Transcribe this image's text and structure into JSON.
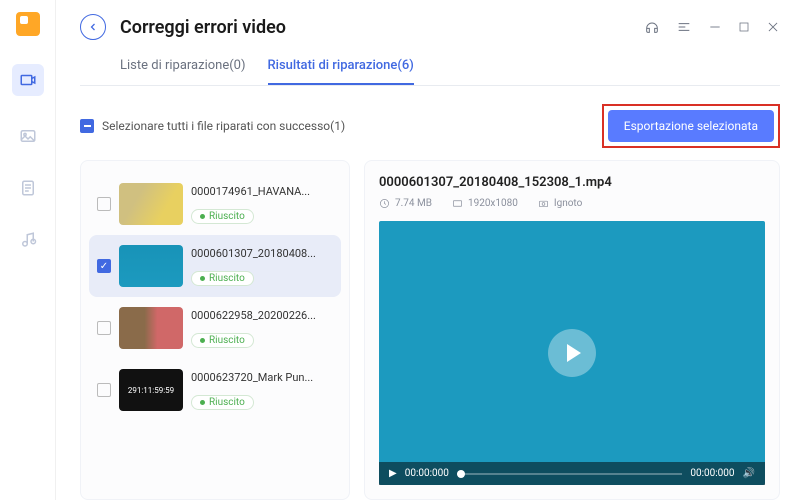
{
  "header": {
    "title": "Correggi errori video"
  },
  "tabs": [
    {
      "label": "Liste di riparazione(0)",
      "active": false
    },
    {
      "label": "Risultati di riparazione(6)",
      "active": true
    }
  ],
  "toolbar": {
    "select_all_label": "Selezionare tutti i file riparati con successo(1)",
    "export_label": "Esportazione selezionata"
  },
  "items": [
    {
      "name": "0000174961_HAVANA...",
      "status": "Riuscito",
      "checked": false,
      "selected": false,
      "thumb": "linear-gradient(120deg,#d0c080 30%,#e8d060 70%)"
    },
    {
      "name": "0000601307_20180408...",
      "status": "Riuscito",
      "checked": true,
      "selected": true,
      "thumb": "linear-gradient(180deg,#1893b8,#1c9abf)"
    },
    {
      "name": "0000622958_20200226...",
      "status": "Riuscito",
      "checked": false,
      "selected": false,
      "thumb": "linear-gradient(90deg,#8a6b4a 40%,#d06868 60%)"
    },
    {
      "name": "0000623720_Mark Pun...",
      "status": "Riuscito",
      "checked": false,
      "selected": false,
      "thumb": "#111",
      "overlay": "291:11:59:59"
    }
  ],
  "preview": {
    "title": "0000601307_20180408_152308_1.mp4",
    "size": "7.74 MB",
    "resolution": "1920x1080",
    "camera": "Ignoto",
    "time_start": "00:00:000",
    "time_end": "00:00:000"
  }
}
